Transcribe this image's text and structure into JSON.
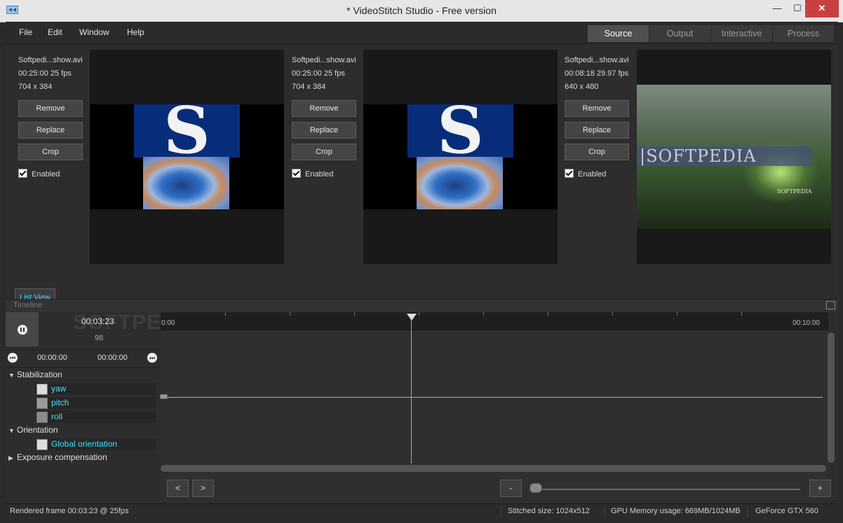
{
  "window": {
    "title": "* VideoStitch Studio - Free version",
    "controls": {
      "minimize": "—",
      "maximize": "☐",
      "close": "✕"
    }
  },
  "menu": [
    "File",
    "Edit",
    "Window",
    "Help"
  ],
  "tabs": [
    {
      "label": "Source",
      "active": true
    },
    {
      "label": "Output",
      "active": false
    },
    {
      "label": "Interactive",
      "active": false
    },
    {
      "label": "Process",
      "active": false
    }
  ],
  "sources": [
    {
      "filename": "Softpedi...show.avi",
      "duration_fps": "00:25:00 25 fps",
      "resolution": "704 x 384",
      "enabled": true
    },
    {
      "filename": "Softpedi...show.avi",
      "duration_fps": "00:25:00 25 fps",
      "resolution": "704 x 384",
      "enabled": true
    },
    {
      "filename": "Softpedi...show.avi",
      "duration_fps": "00:08:18 29.97 fps",
      "resolution": "640 x 480",
      "enabled": true
    }
  ],
  "source_buttons": {
    "remove": "Remove",
    "replace": "Replace",
    "crop": "Crop",
    "enabled": "Enabled"
  },
  "previews": {
    "logo_letter": "S",
    "forest_banner": "|SOFTPEDIA",
    "forest_mark": "SOFTPEDIA"
  },
  "list_view": "List View",
  "timeline": {
    "label": "Timeline",
    "watermark": "SOFTPEDIA",
    "current_time": "00:03:23",
    "current_frame": "98",
    "in_time": "00:00:00",
    "out_time": "00:00:00",
    "ruler_start": "0:00",
    "ruler_end": "00:10:00",
    "playhead_fraction": 0.339,
    "groups": [
      {
        "name": "Stabilization",
        "expanded": true,
        "curves": [
          {
            "name": "yaw",
            "swatch": "#dcdcdc"
          },
          {
            "name": "pitch",
            "swatch": "#9a9a9a"
          },
          {
            "name": "roll",
            "swatch": "#8c8c8c"
          }
        ]
      },
      {
        "name": "Orientation",
        "expanded": true,
        "curves": [
          {
            "name": "Global orientation",
            "swatch": "#dcdcdc"
          }
        ]
      },
      {
        "name": "Exposure compensation",
        "expanded": false,
        "curves": []
      }
    ],
    "nav": {
      "prev": "<",
      "next": ">",
      "zoom_out": "-",
      "zoom_in": "+"
    },
    "zoom_level": 0.0,
    "curve_color": "#d6b81e",
    "playhead_color": "#3ad6e8"
  },
  "status": {
    "rendered": "Rendered frame 00:03:23 @ 25fps",
    "stitched": "Stitched size: 1024x512",
    "gpu": "GPU Memory usage: 669MB/1024MB",
    "card": "GeForce GTX 560"
  }
}
